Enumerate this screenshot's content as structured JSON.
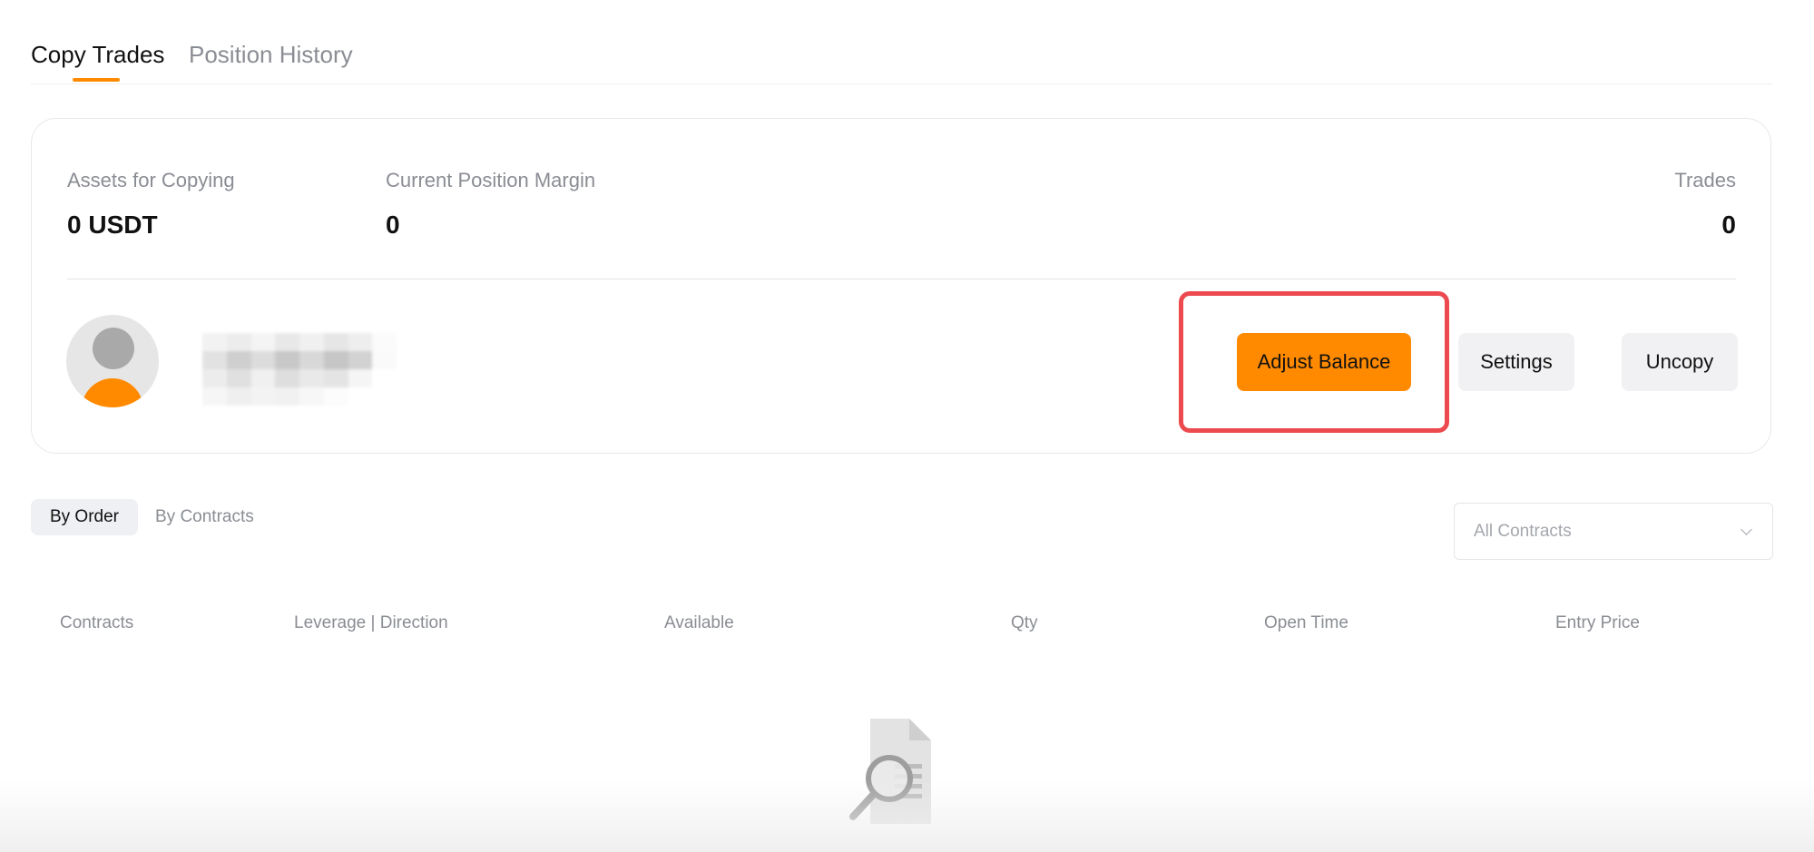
{
  "tabs": {
    "copy_trades": "Copy Trades",
    "position_history": "Position History"
  },
  "summary": {
    "assets_label": "Assets for Copying",
    "assets_value": "0 USDT",
    "margin_label": "Current Position Margin",
    "margin_value": "0",
    "trades_label": "Trades",
    "trades_value": "0"
  },
  "actions": {
    "adjust_balance": "Adjust Balance",
    "settings": "Settings",
    "uncopy": "Uncopy"
  },
  "sub_tabs": {
    "by_order": "By Order",
    "by_contracts": "By Contracts"
  },
  "filter": {
    "selected": "All Contracts"
  },
  "table": {
    "columns": [
      "Contracts",
      "Leverage | Direction",
      "Available",
      "Qty",
      "Open Time",
      "Entry Price"
    ]
  },
  "colors": {
    "accent": "#ff8a00",
    "highlight": "#ec4a4f"
  }
}
